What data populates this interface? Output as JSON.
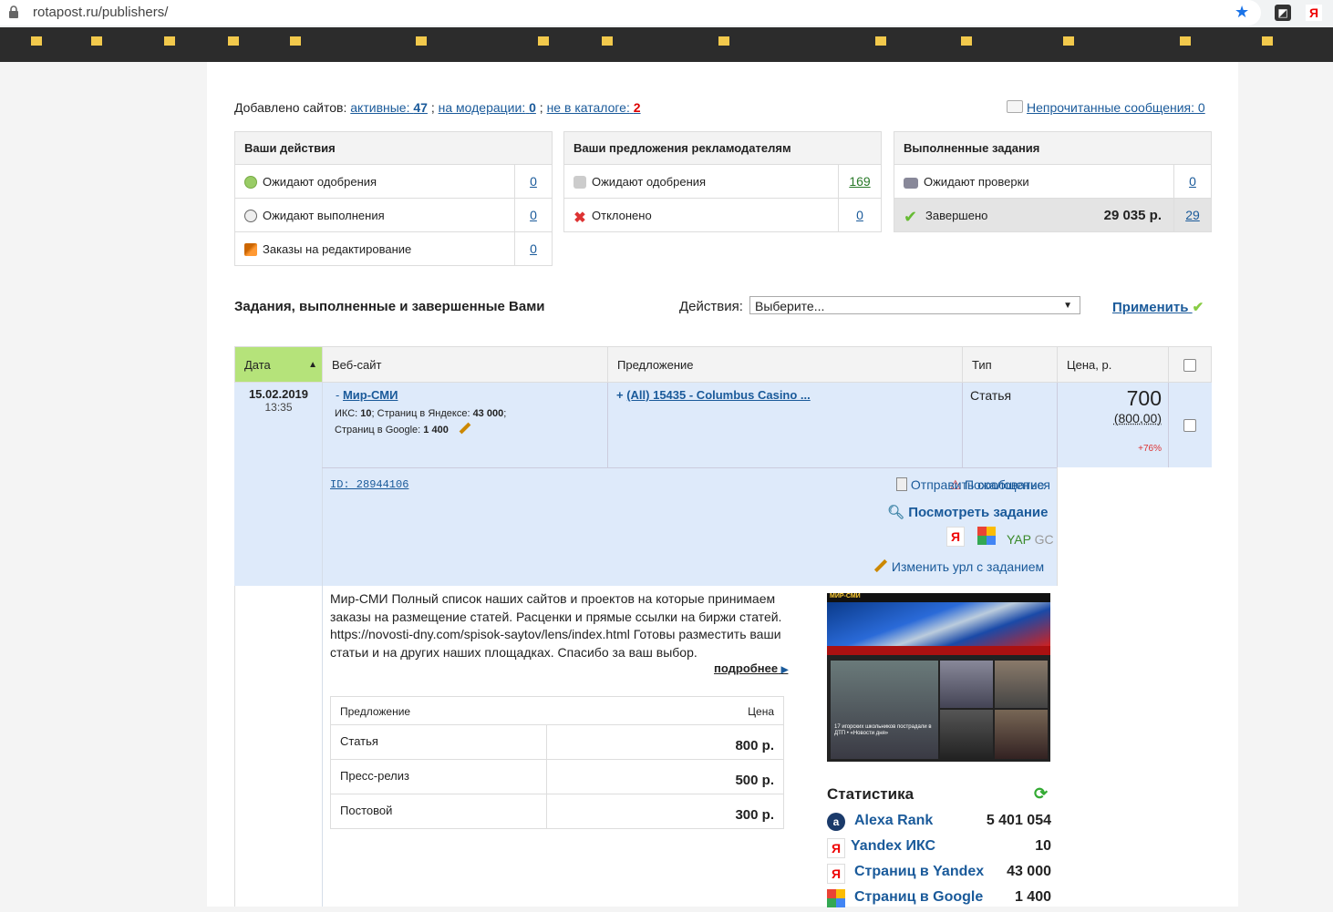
{
  "browser": {
    "url": "rotapost.ru/publishers/"
  },
  "summary": {
    "added_label": "Добавлено сайтов:",
    "active_label": "активные:",
    "active_count": "47",
    "moderation_label": "на модерации:",
    "moderation_count": "0",
    "not_in_catalog_label": "не в каталоге:",
    "not_in_catalog_count": "2",
    "unread_label": "Непрочитанные сообщения: 0"
  },
  "boxes": {
    "actions": {
      "title": "Ваши действия",
      "rows": [
        {
          "label": "Ожидают одобрения",
          "count": "0"
        },
        {
          "label": "Ожидают выполнения",
          "count": "0"
        },
        {
          "label": "Заказы на редактирование",
          "count": "0"
        }
      ]
    },
    "offers": {
      "title": "Ваши предложения рекламодателям",
      "rows": [
        {
          "label": "Ожидают одобрения",
          "count": "169"
        },
        {
          "label": "Отклонено",
          "count": "0"
        }
      ]
    },
    "completed": {
      "title": "Выполненные задания",
      "rows": [
        {
          "label": "Ожидают проверки",
          "count": "0"
        },
        {
          "label": "Завершено",
          "sum": "29 035 р.",
          "count": "29"
        }
      ]
    }
  },
  "tasks": {
    "title": "Задания, выполненные и завершенные Вами",
    "actions_label": "Действия:",
    "select_value": "Выберите...",
    "apply_label": "Применить",
    "columns": [
      "Дата",
      "Веб-сайт",
      "Предложение",
      "Тип",
      "Цена, р."
    ],
    "row": {
      "date": "15.02.2019",
      "time": "13:35",
      "site_name": "Мир-СМИ",
      "site_prefix": "-",
      "iks_label": "ИКС:",
      "iks_value": "10",
      "yandex_pages_label": "Страниц в Яндексе:",
      "yandex_pages_value": "43 000",
      "google_pages_label": "Страниц в Google:",
      "google_pages_value": "1 400",
      "offer_prefix": "+",
      "offer": "(All) 15435 - Columbus Casino ...",
      "type": "Статья",
      "price": "700",
      "price_old": "(800,00)",
      "price_delta": "+76%",
      "id_label": "ID: 28944106",
      "complain": "Пожаловаться",
      "send_message": "Отправить сообщение",
      "view_task": "Посмотреть задание",
      "yap": "YAP",
      "gc": "GC",
      "change_url": "Изменить урл с заданием"
    }
  },
  "site_details": {
    "description": "Мир-СМИ Полный список наших сайтов и проектов на которые принимаем заказы на размещение статей. Расценки и прямые ссылки на биржи статей. https://novosti-dny.com/spisok-saytov/lens/index.html Готовы разместить ваши статьи и на других наших площадках. Спасибо за ваш выбор.",
    "more_label": "подробнее",
    "price_table": {
      "col_offer": "Предложение",
      "col_price": "Цена",
      "rows": [
        {
          "name": "Статья",
          "price": "800 р."
        },
        {
          "name": "Пресс-релиз",
          "price": "500 р."
        },
        {
          "name": "Постовой",
          "price": "300 р."
        }
      ]
    },
    "thumbnail": {
      "logo": "МИР-СМИ",
      "headline": "17 игорских школьников пострадали в ДТП • «Новости дня»"
    },
    "stats": {
      "title": "Статистика",
      "rows": [
        {
          "name": "Alexa Rank",
          "value": "5 401 054"
        },
        {
          "name": "Yandex ИКС",
          "value": "10"
        },
        {
          "name": "Страниц в Yandex",
          "value": "43 000"
        },
        {
          "name": "Страниц в Google",
          "value": "1 400"
        }
      ]
    }
  }
}
